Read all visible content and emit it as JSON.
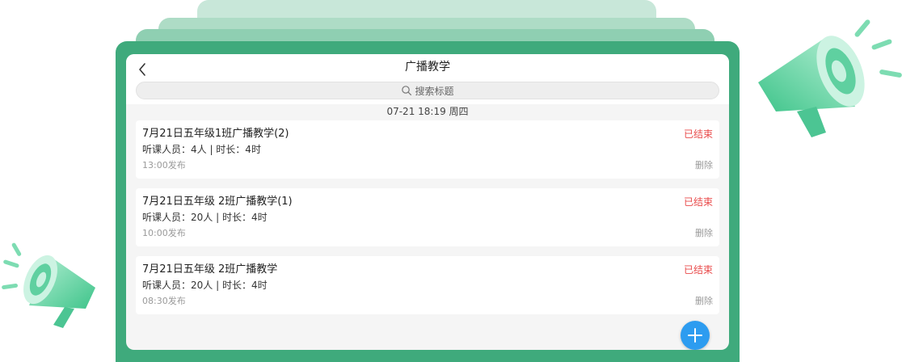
{
  "header": {
    "title": "广播教学",
    "back_icon": "chevron-left-icon"
  },
  "search": {
    "placeholder": "搜索标题",
    "icon": "search-icon"
  },
  "date_separator": "07-21 18:19  周四",
  "items": [
    {
      "title": "7月21日五年级1班广播教学(2)",
      "status": "已结束",
      "meta": "听课人员：4人  |  时长：4时",
      "time": "13:00发布",
      "delete": "删除"
    },
    {
      "title": "7月21日五年级 2班广播教学(1)",
      "status": "已结束",
      "meta": "听课人员：20人  |  时长：4时",
      "time": "10:00发布",
      "delete": "删除"
    },
    {
      "title": "7月21日五年级 2班广播教学",
      "status": "已结束",
      "meta": "听课人员：20人  |  时长：4时",
      "time": "08:30发布",
      "delete": "删除"
    }
  ],
  "colors": {
    "accent_green": "#3faa7c",
    "status_red": "#e94b4b",
    "fab_blue": "#2d9cf0"
  },
  "fab_icon": "plus-icon"
}
